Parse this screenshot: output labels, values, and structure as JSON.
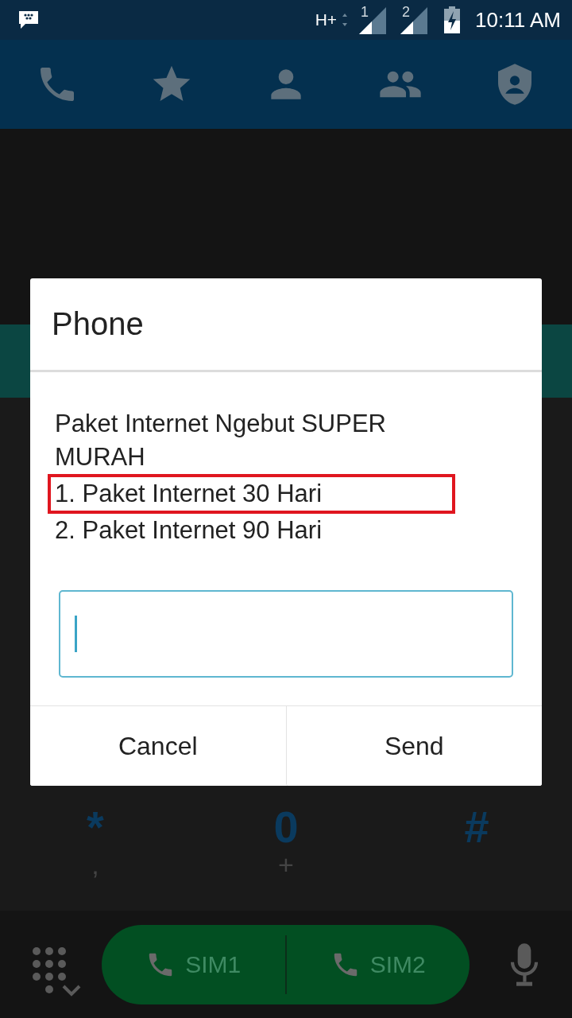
{
  "status_bar": {
    "network": "H+",
    "sim_labels": [
      "1",
      "2"
    ],
    "time": "10:11 AM"
  },
  "tabs": [
    {
      "kind": "phone"
    },
    {
      "kind": "star"
    },
    {
      "kind": "person"
    },
    {
      "kind": "group"
    },
    {
      "kind": "shield"
    }
  ],
  "dialpad": {
    "keys": [
      {
        "symbol": "*",
        "sub": ","
      },
      {
        "symbol": "0",
        "sub": "+"
      },
      {
        "symbol": "#"
      }
    ]
  },
  "call_bar": {
    "buttons": [
      {
        "label": "SIM1"
      },
      {
        "label": "SIM2"
      }
    ]
  },
  "dialog": {
    "title": "Phone",
    "message": [
      {
        "text": "Paket Internet Ngebut SUPER MURAH",
        "highlighted": false
      },
      {
        "text": "1. Paket Internet 30 Hari",
        "highlighted": true
      },
      {
        "text": "2. Paket Internet 90 Hari",
        "highlighted": false
      }
    ],
    "buttons": [
      "Cancel",
      "Send"
    ]
  }
}
